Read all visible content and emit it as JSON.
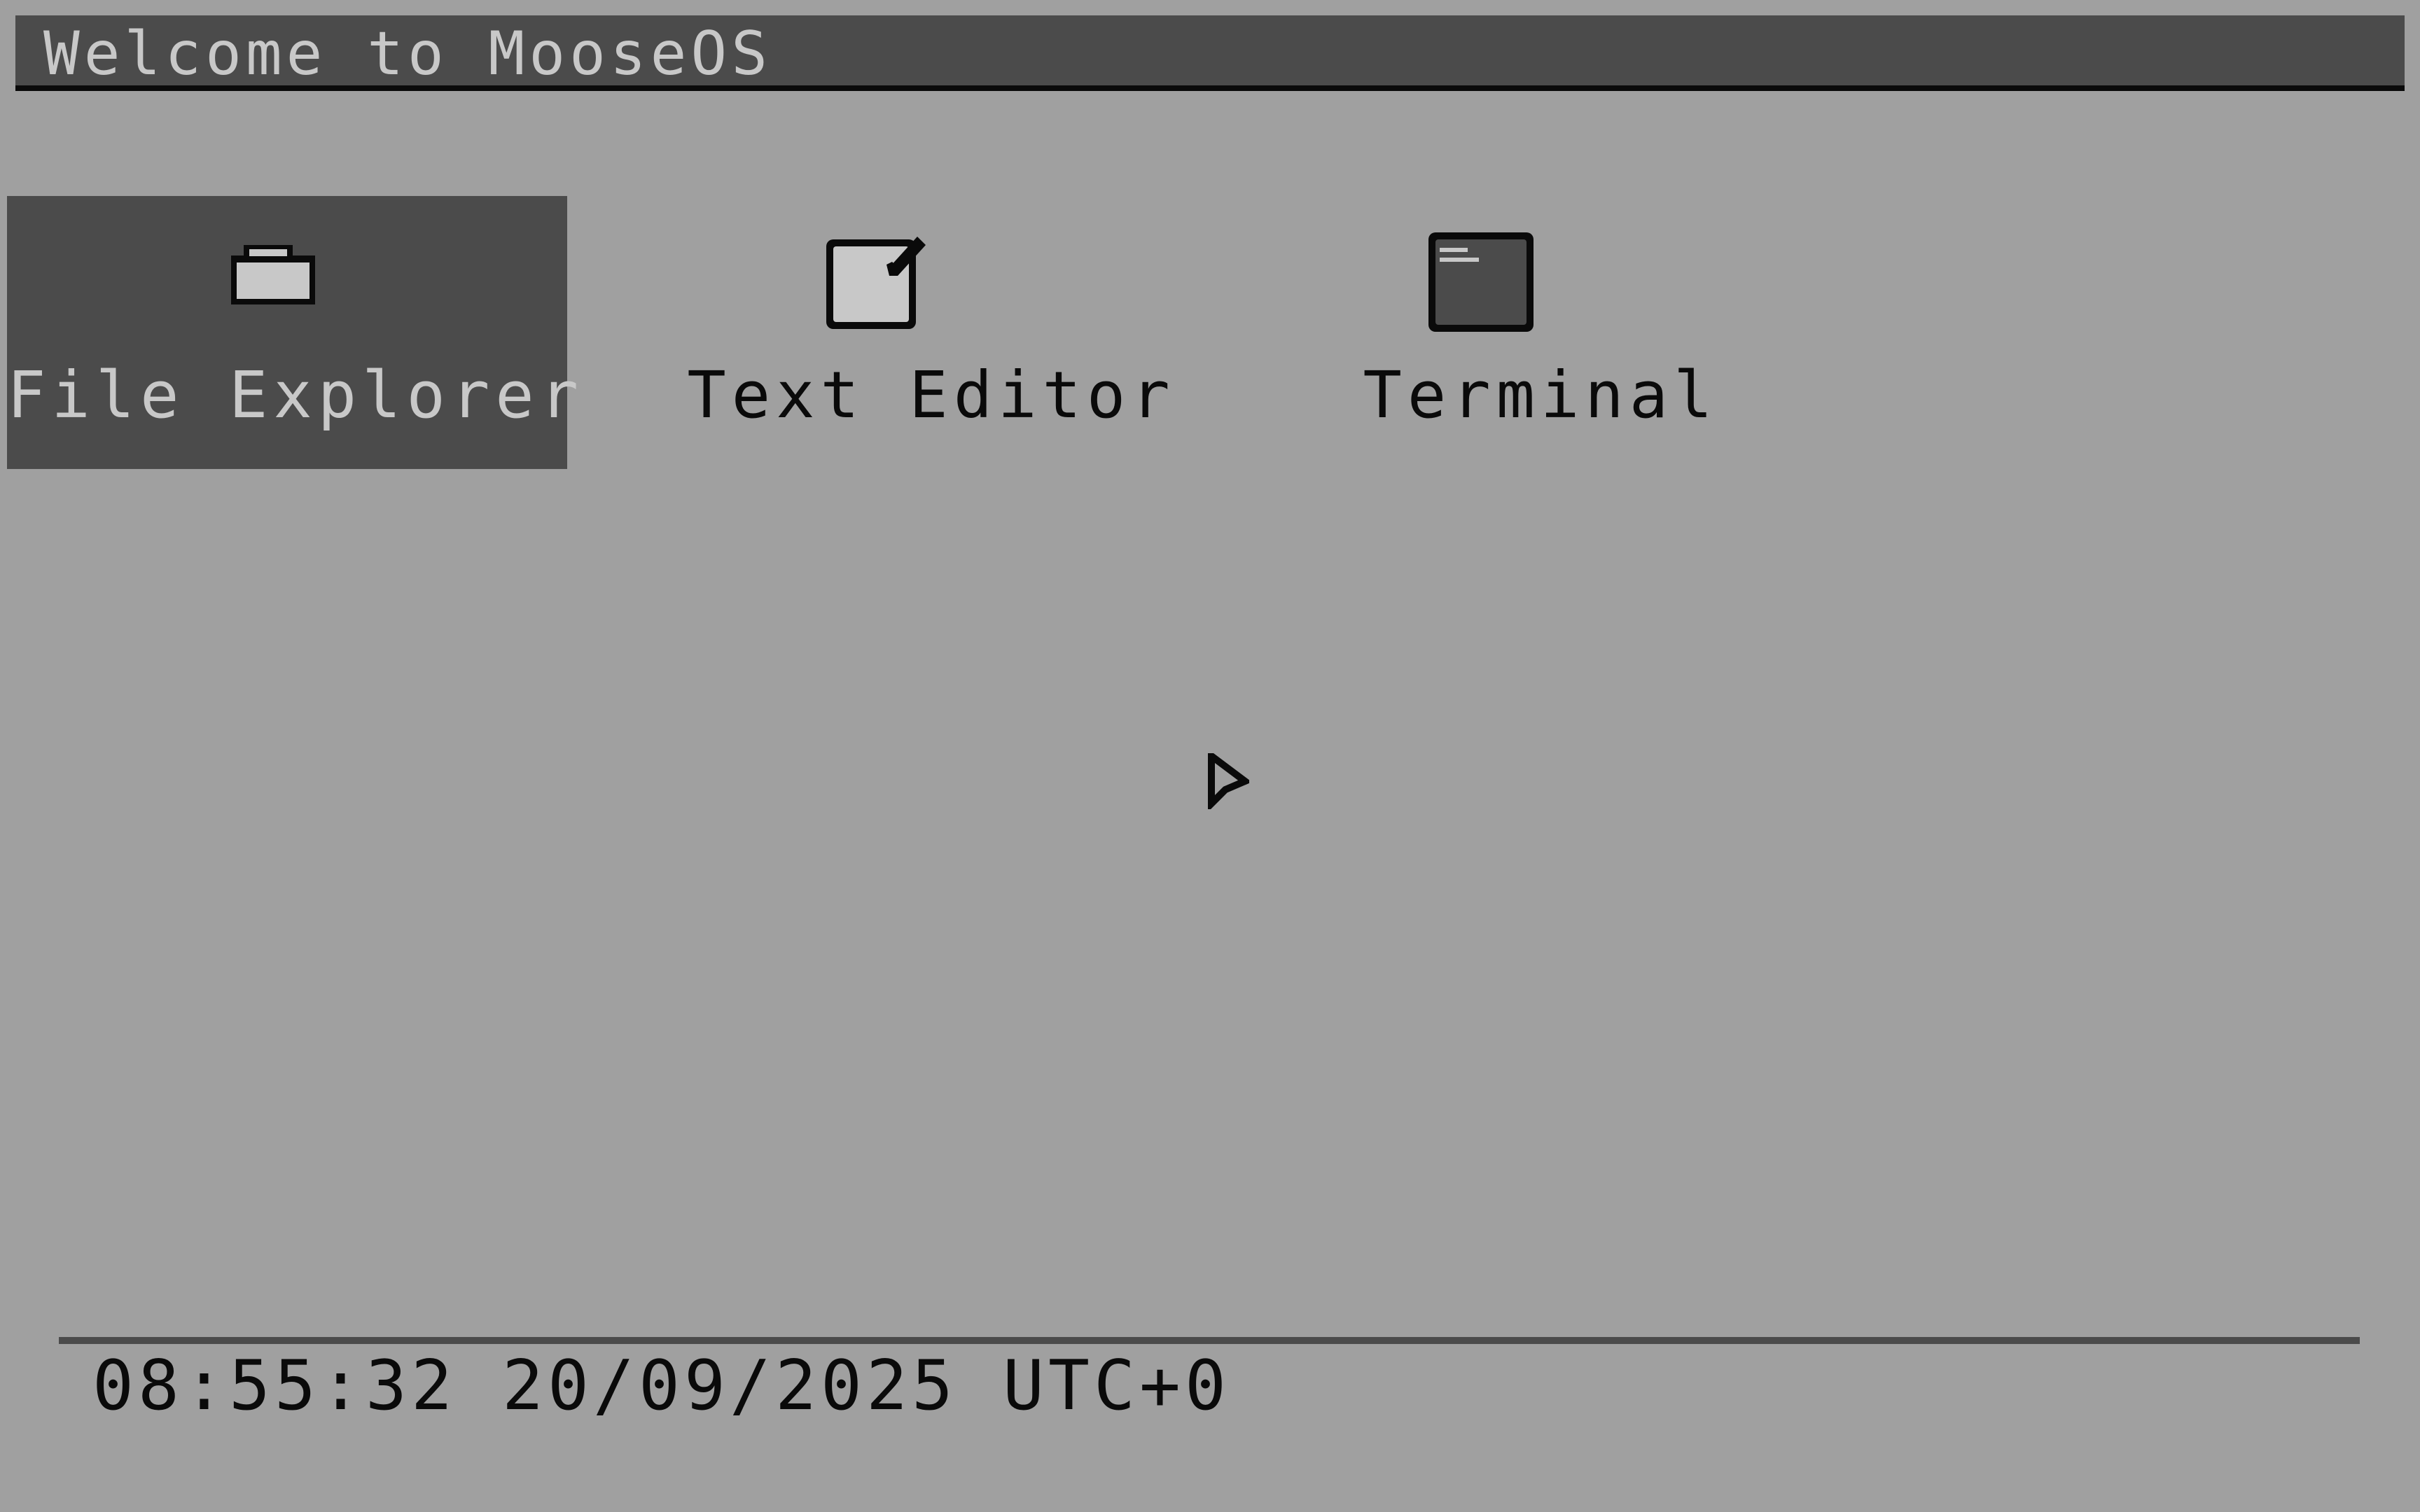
{
  "title_bar": {
    "text": "Welcome to MooseOS"
  },
  "desktop": {
    "icons": [
      {
        "label": "File Explorer",
        "icon": "folder-icon",
        "selected": true
      },
      {
        "label": "Text Editor",
        "icon": "text-editor-icon",
        "selected": false
      },
      {
        "label": "Terminal",
        "icon": "terminal-icon",
        "selected": false
      }
    ]
  },
  "taskbar": {
    "clock": "08:55:32 20/09/2025 UTC+0"
  },
  "colors": {
    "desktop_background": "#a0a0a0",
    "bar_background": "#4b4b4b",
    "light_text": "#c8c8c8",
    "dark_text": "#0a0a0a"
  }
}
